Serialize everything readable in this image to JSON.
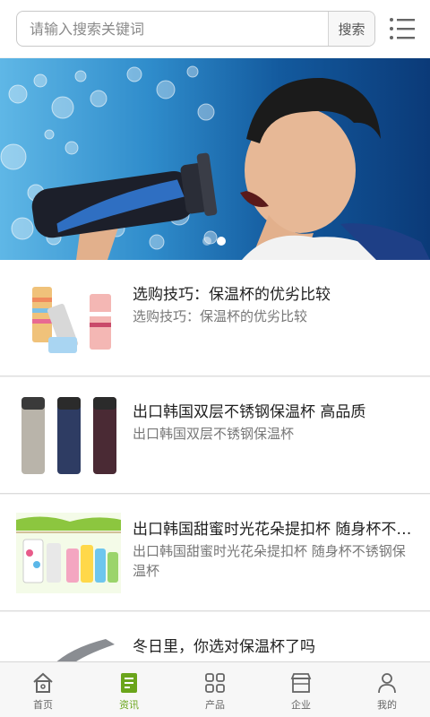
{
  "search": {
    "placeholder": "请输入搜索关键词",
    "button_label": "搜索"
  },
  "banner": {
    "slides_count": 2,
    "active_slide": 2
  },
  "articles": [
    {
      "title": "选购技巧：保温杯的优劣比较",
      "description": "选购技巧：保温杯的优劣比较"
    },
    {
      "title": "出口韩国双层不锈钢保温杯 高品质",
      "description": "出口韩国双层不锈钢保温杯"
    },
    {
      "title": "出口韩国甜蜜时光花朵提扣杯 随身杯不锈钢保温杯",
      "description": "出口韩国甜蜜时光花朵提扣杯 随身杯不锈钢保温杯"
    },
    {
      "title": "冬日里，你选对保温杯了吗",
      "description": ""
    }
  ],
  "nav": {
    "items": [
      {
        "label": "首页",
        "icon": "home-icon",
        "active": false
      },
      {
        "label": "资讯",
        "icon": "news-icon",
        "active": true
      },
      {
        "label": "产品",
        "icon": "grid-icon",
        "active": false
      },
      {
        "label": "企业",
        "icon": "store-icon",
        "active": false
      },
      {
        "label": "我的",
        "icon": "user-icon",
        "active": false
      }
    ],
    "active_color": "#6aa51b",
    "inactive_color": "#666666"
  }
}
